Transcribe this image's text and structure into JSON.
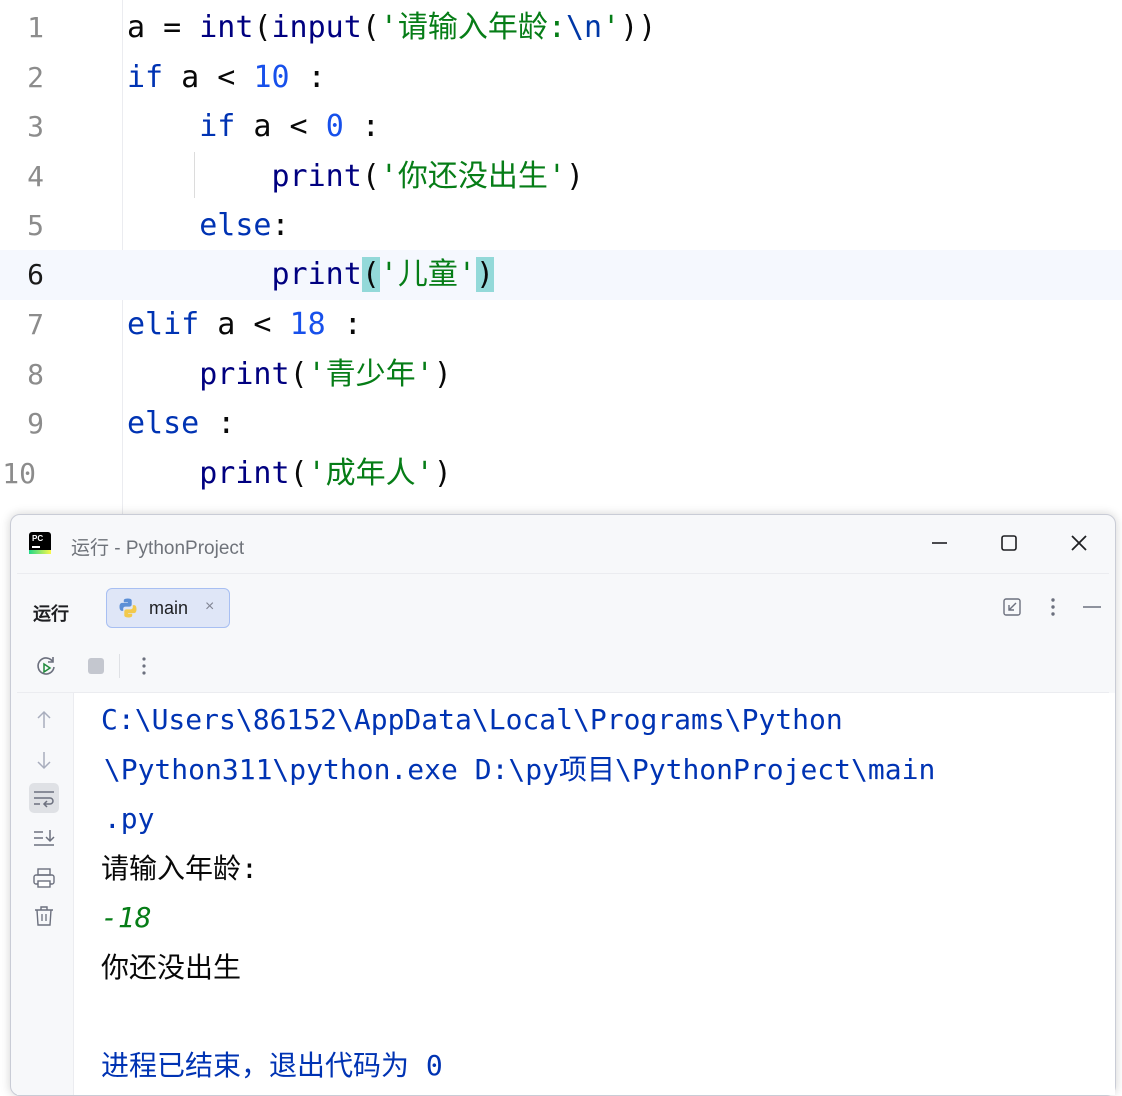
{
  "editor": {
    "lines": [
      {
        "num": "1",
        "tokens": [
          {
            "t": "a = ",
            "c": ""
          },
          {
            "t": "int",
            "c": "fn"
          },
          {
            "t": "(",
            "c": ""
          },
          {
            "t": "input",
            "c": "fn"
          },
          {
            "t": "(",
            "c": ""
          },
          {
            "t": "'请输入年龄:",
            "c": "str"
          },
          {
            "t": "\\n",
            "c": "esc"
          },
          {
            "t": "'",
            "c": "str"
          },
          {
            "t": "))",
            "c": ""
          }
        ]
      },
      {
        "num": "2",
        "tokens": [
          {
            "t": "if",
            "c": "kw"
          },
          {
            "t": " a < ",
            "c": ""
          },
          {
            "t": "10",
            "c": "num"
          },
          {
            "t": " :",
            "c": ""
          }
        ]
      },
      {
        "num": "3",
        "tokens": [
          {
            "t": "    ",
            "c": ""
          },
          {
            "t": "if",
            "c": "kw"
          },
          {
            "t": " a < ",
            "c": ""
          },
          {
            "t": "0",
            "c": "num"
          },
          {
            "t": " :",
            "c": ""
          }
        ]
      },
      {
        "num": "4",
        "tokens": [
          {
            "t": "        ",
            "c": ""
          },
          {
            "t": "print",
            "c": "fn"
          },
          {
            "t": "(",
            "c": ""
          },
          {
            "t": "'你还没出生'",
            "c": "str"
          },
          {
            "t": ")",
            "c": ""
          }
        ]
      },
      {
        "num": "5",
        "tokens": [
          {
            "t": "    ",
            "c": ""
          },
          {
            "t": "else",
            "c": "kw"
          },
          {
            "t": ":",
            "c": ""
          }
        ]
      },
      {
        "num": "6",
        "current": true,
        "tokens": [
          {
            "t": "        ",
            "c": ""
          },
          {
            "t": "print",
            "c": "fn"
          },
          {
            "t": "(",
            "c": "brk"
          },
          {
            "t": "'儿童'",
            "c": "str"
          },
          {
            "t": ")",
            "c": "brk"
          }
        ]
      },
      {
        "num": "7",
        "tokens": [
          {
            "t": "elif",
            "c": "kw"
          },
          {
            "t": " a < ",
            "c": ""
          },
          {
            "t": "18",
            "c": "num"
          },
          {
            "t": " :",
            "c": ""
          }
        ]
      },
      {
        "num": "8",
        "tokens": [
          {
            "t": "    ",
            "c": ""
          },
          {
            "t": "print",
            "c": "fn"
          },
          {
            "t": "(",
            "c": ""
          },
          {
            "t": "'青少年'",
            "c": "str"
          },
          {
            "t": ")",
            "c": ""
          }
        ]
      },
      {
        "num": "9",
        "tokens": [
          {
            "t": "else",
            "c": "kw"
          },
          {
            "t": " :",
            "c": ""
          }
        ]
      },
      {
        "num": "10",
        "tokens": [
          {
            "t": "    ",
            "c": ""
          },
          {
            "t": "print",
            "c": "fn"
          },
          {
            "t": "(",
            "c": ""
          },
          {
            "t": "'成年人'",
            "c": "str"
          },
          {
            "t": ")",
            "c": ""
          }
        ]
      }
    ]
  },
  "run_window": {
    "title": "运行 - PythonProject",
    "app_icon": "pycharm-icon",
    "toolbar": {
      "label": "运行",
      "tab_label": "main",
      "tab_close": "×"
    },
    "console": {
      "lines": [
        {
          "text": "C:\\Users\\86152\\AppData\\Local\\Programs\\Python",
          "kind": "path"
        },
        {
          "text": " \\Python311\\python.exe D:\\py项目\\PythonProject\\main",
          "kind": "path"
        },
        {
          "text": " .py",
          "kind": "path"
        },
        {
          "text": "请输入年龄:",
          "kind": "plain"
        },
        {
          "text": "-18",
          "kind": "input"
        },
        {
          "text": "你还没出生",
          "kind": "plain"
        },
        {
          "text": "",
          "kind": "plain"
        },
        {
          "text": "进程已结束，退出代码为 0",
          "kind": "exit"
        }
      ]
    }
  },
  "colors": {
    "keyword": "#0033b3",
    "number": "#1750eb",
    "string": "#067d17",
    "bracket_highlight": "#93d9d9",
    "current_line": "#f5f8fe"
  }
}
